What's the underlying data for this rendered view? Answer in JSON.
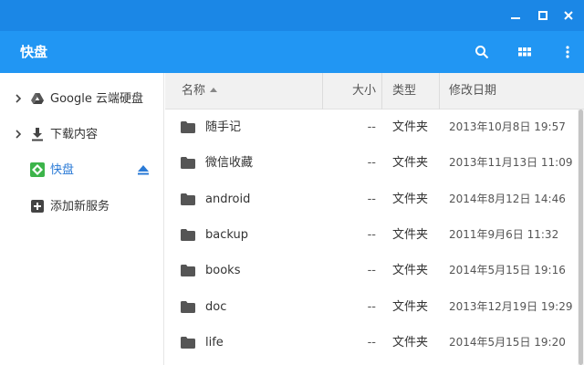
{
  "window": {
    "minimize_icon": "minimize-icon",
    "maximize_icon": "maximize-icon",
    "close_icon": "close-icon"
  },
  "appbar": {
    "title": "快盘",
    "search_icon": "search-icon",
    "grid_icon": "grid-view-icon",
    "more_icon": "more-vert-icon"
  },
  "sidebar": {
    "items": [
      {
        "label": "Google 云端硬盘",
        "icon": "google-drive-icon",
        "expandable": true
      },
      {
        "label": "下载内容",
        "icon": "download-icon",
        "expandable": true
      },
      {
        "label": "快盘",
        "icon": "kuaipan-icon",
        "active": true,
        "eject_icon": "eject-icon"
      },
      {
        "label": "添加新服务",
        "icon": "add-box-icon"
      }
    ]
  },
  "table": {
    "headers": {
      "name": "名称",
      "size": "大小",
      "type": "类型",
      "modified": "修改日期"
    },
    "rows": [
      {
        "name": "随手记",
        "size": "--",
        "type": "文件夹",
        "modified": "2013年10月8日 19:57"
      },
      {
        "name": "微信收藏",
        "size": "--",
        "type": "文件夹",
        "modified": "2013年11月13日 11:09"
      },
      {
        "name": "android",
        "size": "--",
        "type": "文件夹",
        "modified": "2014年8月12日 14:46"
      },
      {
        "name": "backup",
        "size": "--",
        "type": "文件夹",
        "modified": "2011年9月6日 11:32"
      },
      {
        "name": "books",
        "size": "--",
        "type": "文件夹",
        "modified": "2014年5月15日 19:16"
      },
      {
        "name": "doc",
        "size": "--",
        "type": "文件夹",
        "modified": "2013年12月19日 19:29"
      },
      {
        "name": "life",
        "size": "--",
        "type": "文件夹",
        "modified": "2014年5月15日 19:20"
      }
    ]
  },
  "colors": {
    "titlebar": "#1b87e6",
    "appbar": "#2196f3",
    "active_nav": "#2a7ad6",
    "kuaipan_brand": "#3cb44a"
  }
}
